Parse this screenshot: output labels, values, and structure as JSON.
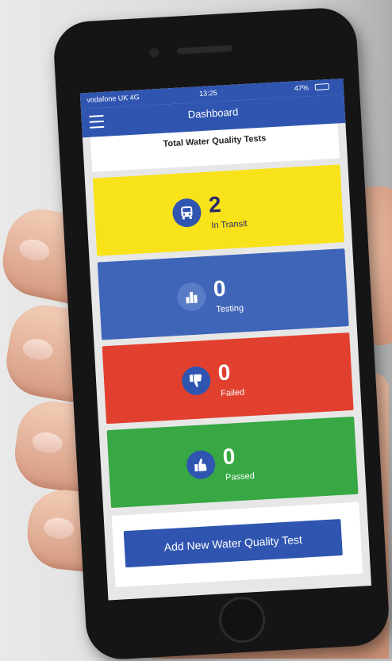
{
  "status_bar": {
    "carrier": "vodafone UK 4G",
    "time": "13:25",
    "battery": "47%"
  },
  "header": {
    "title": "Dashboard"
  },
  "subheader": {
    "title": "Total Water Quality Tests"
  },
  "cards": [
    {
      "count": "2",
      "label": "In Transit",
      "icon": "bus-icon",
      "color": "#f8e21a"
    },
    {
      "count": "0",
      "label": "Testing",
      "icon": "bar-chart-icon",
      "color": "#3f65b9"
    },
    {
      "count": "0",
      "label": "Failed",
      "icon": "thumbs-down-icon",
      "color": "#e2402f"
    },
    {
      "count": "0",
      "label": "Passed",
      "icon": "thumbs-up-icon",
      "color": "#37a844"
    }
  ],
  "actions": {
    "add_button": "Add New Water Quality Test"
  }
}
